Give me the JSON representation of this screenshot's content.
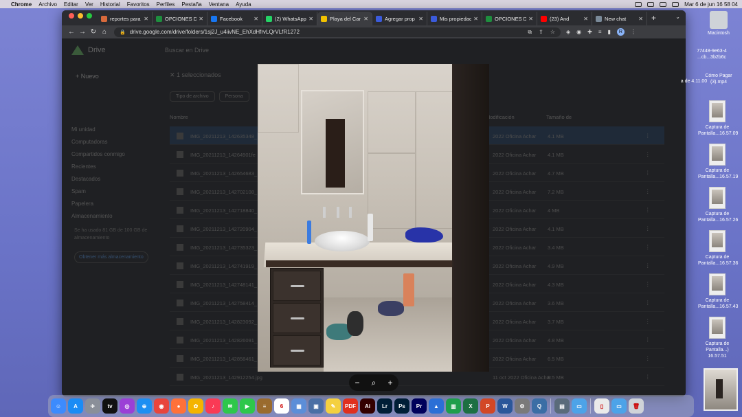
{
  "menubar": {
    "app": "Chrome",
    "items": [
      "Archivo",
      "Editar",
      "Ver",
      "Historial",
      "Favoritos",
      "Perfiles",
      "Pestaña",
      "Ventana",
      "Ayuda"
    ],
    "datetime": "Mar 6 de jun  16 58 04"
  },
  "tabs": [
    {
      "title": "reportes para",
      "color": "#d86a3c"
    },
    {
      "title": "OPCIONES D",
      "color": "#1e8e3e"
    },
    {
      "title": "Facebook",
      "color": "#1877f2"
    },
    {
      "title": "(2) WhatsApp",
      "color": "#25d366"
    },
    {
      "title": "Playa del Car",
      "color": "#f2c200",
      "active": true
    },
    {
      "title": "Agregar prop",
      "color": "#3b5bdb"
    },
    {
      "title": "Mis propiedad",
      "color": "#3b5bdb"
    },
    {
      "title": "OPCIONES D",
      "color": "#1e8e3e"
    },
    {
      "title": "(23) And",
      "color": "#ff0000"
    },
    {
      "title": "New chat",
      "color": "#7a8a99"
    }
  ],
  "toolbar": {
    "url": "drive.google.com/drive/folders/1sj2J_u4iivNE_EhXdHfrvLQrVLfR1272",
    "profile_initial": "R"
  },
  "drive": {
    "app_name": "Drive",
    "search_placeholder": "Buscar en Drive",
    "new_label": "Nuevo",
    "nav": [
      "Mi unidad",
      "Computadoras",
      "Compartidos conmigo",
      "Recientes",
      "Destacados",
      "Spam",
      "Papelera",
      "Almacenamiento"
    ],
    "storage_text": "Se ha usado 81 GB de 100 GB de almacenamiento",
    "get_storage": "Obtener más almacenamiento",
    "selection": "1 seleccionados",
    "filters": [
      "Tipo de archivo",
      "Persona"
    ],
    "col_name": "Nombre",
    "col_modified": "Modificación",
    "col_size": "Tamaño de",
    "rows": [
      {
        "name": "IMG_20211213_142635348_",
        "owner": "2022 Oficina Achar",
        "size": "4.1 MB",
        "selected": true
      },
      {
        "name": "IMG_20211213_14264901fe",
        "owner": "2022 Oficina Achar",
        "size": "4.1 MB"
      },
      {
        "name": "IMG_20211213_142654683_",
        "owner": "2022 Oficina Achar",
        "size": "4.7 MB"
      },
      {
        "name": "IMG_20211213_142702108_",
        "owner": "2022 Oficina Achar",
        "size": "7.2 MB"
      },
      {
        "name": "IMG_20211213_142718840_",
        "owner": "2022 Oficina Achar",
        "size": "4 MB"
      },
      {
        "name": "IMG_20211213_142720904_",
        "owner": "2022 Oficina Achar",
        "size": "4.1 MB"
      },
      {
        "name": "IMG_20211213_142735323_",
        "owner": "2022 Oficina Achar",
        "size": "3.4 MB"
      },
      {
        "name": "IMG_20211213_142741919_",
        "owner": "2022 Oficina Achar",
        "size": "4.9 MB"
      },
      {
        "name": "IMG_20211213_142748141_",
        "owner": "2022 Oficina Achar",
        "size": "4.3 MB"
      },
      {
        "name": "IMG_20211213_142758414_",
        "owner": "2022 Oficina Achar",
        "size": "3.6 MB"
      },
      {
        "name": "IMG_20211213_142823092_",
        "owner": "2022 Oficina Achar",
        "size": "3.7 MB"
      },
      {
        "name": "IMG_20211213_142826091_",
        "owner": "2022 Oficina Achar",
        "size": "4.8 MB"
      },
      {
        "name": "IMG_20211213_142858461_",
        "owner": "2022 Oficina Achar",
        "size": "6.5 MB"
      },
      {
        "name": "IMG_20211213_142912254.jpg",
        "owner": "11 oct 2022 Oficina Achar",
        "size": "5.5 MB"
      }
    ]
  },
  "desktop_files": [
    {
      "label": "Macintosh"
    },
    {
      "label": "77448-9e63-4 ...cb...3b2b6c"
    },
    {
      "label": "Cómo Pagar (3).mp4"
    },
    {
      "label": "a de 4.11.00"
    },
    {
      "label": "Captura de Pantalla...16.57.09"
    },
    {
      "label": "Captura de Pantalla...16.57.19"
    },
    {
      "label": "Captura de Pantalla...16.57.26"
    },
    {
      "label": "Captura de Pantalla...16.57.36"
    },
    {
      "label": "Captura de Pantalla...16.57.43"
    },
    {
      "label": "Captura de Pantalla...) 16.57.51"
    }
  ],
  "dock": [
    {
      "name": "finder",
      "color": "#3d8bfd",
      "glyph": "☺"
    },
    {
      "name": "app-store",
      "color": "#1b8cf5",
      "glyph": "A"
    },
    {
      "name": "launchpad",
      "color": "#8a8f99",
      "glyph": "✈"
    },
    {
      "name": "apple-tv",
      "color": "#111",
      "glyph": "tv"
    },
    {
      "name": "podcasts",
      "color": "#9b3fd6",
      "glyph": "◎"
    },
    {
      "name": "safari",
      "color": "#1d8ff2",
      "glyph": "⊕"
    },
    {
      "name": "chrome",
      "color": "#e8453c",
      "glyph": "◉"
    },
    {
      "name": "firefox",
      "color": "#ff7139",
      "glyph": "●"
    },
    {
      "name": "photos",
      "color": "#f4b400",
      "glyph": "✿"
    },
    {
      "name": "music",
      "color": "#fa3a55",
      "glyph": "♪"
    },
    {
      "name": "messages",
      "color": "#2ec74b",
      "glyph": "✉"
    },
    {
      "name": "facetime",
      "color": "#2ec74b",
      "glyph": "▶"
    },
    {
      "name": "notes-app",
      "color": "#9a6b2e",
      "glyph": "≡"
    },
    {
      "name": "calendar",
      "color": "#ffffff",
      "glyph": "6"
    },
    {
      "name": "preview",
      "color": "#5c8ed8",
      "glyph": "▦"
    },
    {
      "name": "image-capture",
      "color": "#4a6fa5",
      "glyph": "▣"
    },
    {
      "name": "notes",
      "color": "#f4d03f",
      "glyph": "✎"
    },
    {
      "name": "pdf",
      "color": "#e0301e",
      "glyph": "PDF"
    },
    {
      "name": "illustrator",
      "color": "#330000",
      "glyph": "Ai"
    },
    {
      "name": "lightroom",
      "color": "#001e36",
      "glyph": "Lr"
    },
    {
      "name": "photoshop",
      "color": "#001e36",
      "glyph": "Ps"
    },
    {
      "name": "premiere",
      "color": "#00005b",
      "glyph": "Pr"
    },
    {
      "name": "keynote",
      "color": "#2b6fd6",
      "glyph": "▲"
    },
    {
      "name": "numbers",
      "color": "#1e9e4b",
      "glyph": "▥"
    },
    {
      "name": "excel",
      "color": "#1d6f42",
      "glyph": "X"
    },
    {
      "name": "powerpoint",
      "color": "#d24726",
      "glyph": "P"
    },
    {
      "name": "word",
      "color": "#2b579a",
      "glyph": "W"
    },
    {
      "name": "system-preferences",
      "color": "#7a7a7a",
      "glyph": "⚙"
    },
    {
      "name": "quicktime",
      "color": "#3b6ea5",
      "glyph": "Q"
    },
    {
      "name": "scanner",
      "color": "#5a6b7a",
      "glyph": "▤"
    },
    {
      "name": "folder",
      "color": "#4da3e8",
      "glyph": "▭"
    },
    {
      "name": "documents",
      "color": "#eaeaea",
      "glyph": "▯"
    },
    {
      "name": "downloads",
      "color": "#4da3e8",
      "glyph": "▭"
    },
    {
      "name": "trash",
      "color": "#cfd3d8",
      "glyph": "🗑"
    }
  ],
  "viewer": {
    "zoom_out": "−",
    "zoom": "⌕",
    "zoom_in": "+"
  }
}
